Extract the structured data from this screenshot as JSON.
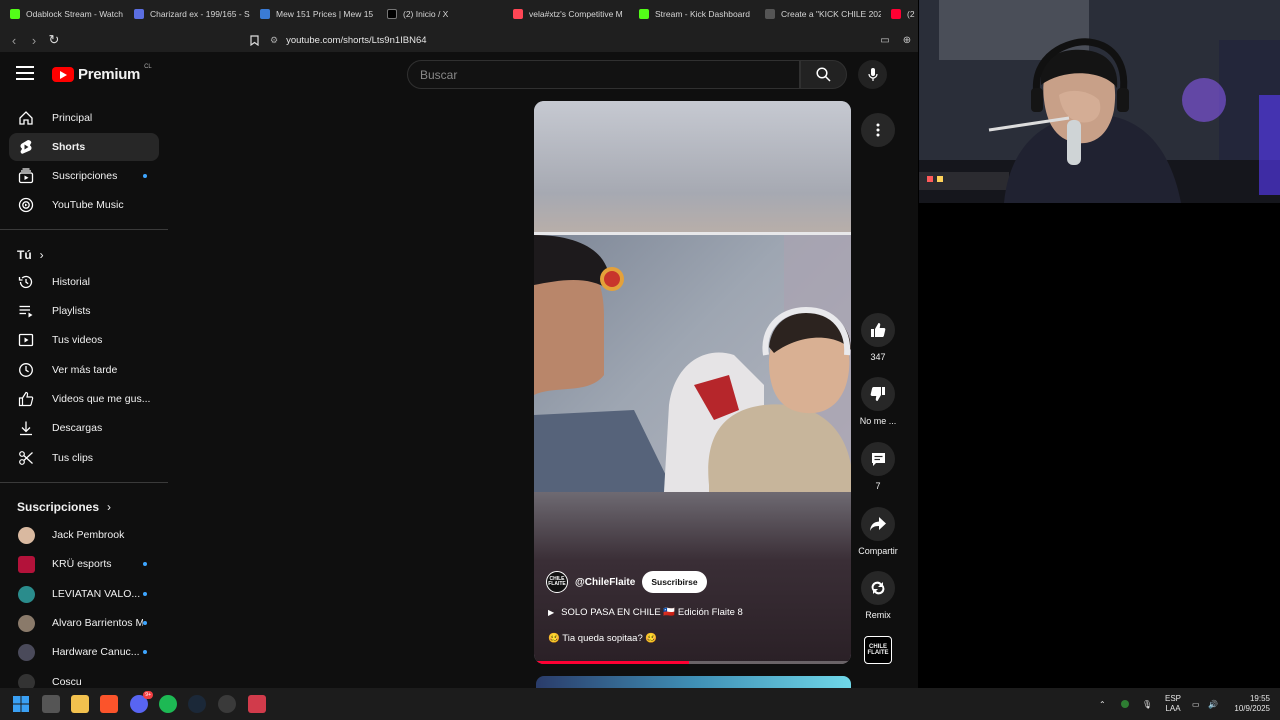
{
  "browser": {
    "tabs": [
      {
        "title": "Odablock Stream - Watch",
        "color": "#53fc18"
      },
      {
        "title": "Charizard ex - 199/165 - S",
        "color": "#5b6ee1"
      },
      {
        "title": "Mew 151 Prices | Mew 15",
        "color": "#3a7bd5"
      },
      {
        "title": "(2) Inicio / X",
        "color": "#000000"
      },
      {
        "title": "vela#xtz's Competitive M",
        "color": "#ff4655"
      },
      {
        "title": "Stream - Kick Dashboard",
        "color": "#53fc18"
      },
      {
        "title": "Create a \"KICK CHILE 2025",
        "color": "#444444"
      },
      {
        "title": "(2",
        "color": "#ff0033"
      }
    ],
    "url": "youtube.com/shorts/Lts9n1IBN64"
  },
  "youtube": {
    "brand": "Premium",
    "country": "CL",
    "search_placeholder": "Buscar",
    "sidebar": {
      "main": [
        {
          "label": "Principal",
          "icon": "home-icon"
        },
        {
          "label": "Shorts",
          "icon": "shorts-icon",
          "active": true
        },
        {
          "label": "Suscripciones",
          "icon": "subscriptions-icon",
          "dot": true
        },
        {
          "label": "YouTube Music",
          "icon": "music-icon"
        }
      ],
      "you_header": "Tú",
      "you": [
        {
          "label": "Historial",
          "icon": "history-icon"
        },
        {
          "label": "Playlists",
          "icon": "playlist-icon"
        },
        {
          "label": "Tus videos",
          "icon": "video-icon"
        },
        {
          "label": "Ver más tarde",
          "icon": "clock-icon"
        },
        {
          "label": "Videos que me gus...",
          "icon": "thumbs-up-icon"
        },
        {
          "label": "Descargas",
          "icon": "download-icon"
        },
        {
          "label": "Tus clips",
          "icon": "scissors-icon"
        }
      ],
      "subs_header": "Suscripciones",
      "subs": [
        {
          "label": "Jack Pembrook",
          "dot": false,
          "color": "#d9b9a0"
        },
        {
          "label": "KRÜ esports",
          "dot": true,
          "color": "#b3123a"
        },
        {
          "label": "LEVIATAN VALO...",
          "dot": true,
          "color": "#2a8c8c"
        },
        {
          "label": "Alvaro Barrientos M...",
          "dot": true,
          "color": "#8a7a6a"
        },
        {
          "label": "Hardware Canuc...",
          "dot": true,
          "color": "#4a4a5a"
        },
        {
          "label": "Coscu",
          "dot": false,
          "color": "#333333"
        }
      ]
    },
    "short": {
      "channel": "@ChileFlaite",
      "channel_avatar_text": "CHILE FLAITE",
      "subscribe": "Suscribirse",
      "playlist": "SOLO PASA EN CHILE 🇨🇱 Edición Flaite 8",
      "caption": "🥴 Tia queda sopitaa? 🥴",
      "progress": 0.49
    },
    "actions": {
      "likes": "347",
      "dislike": "No me ...",
      "comments": "7",
      "share": "Compartir",
      "remix": "Remix"
    }
  },
  "taskbar": {
    "lang_top": "ESP",
    "lang_bottom": "LAA",
    "time": "19:55",
    "date": "10/9/2025",
    "discord_badge": "9+"
  }
}
